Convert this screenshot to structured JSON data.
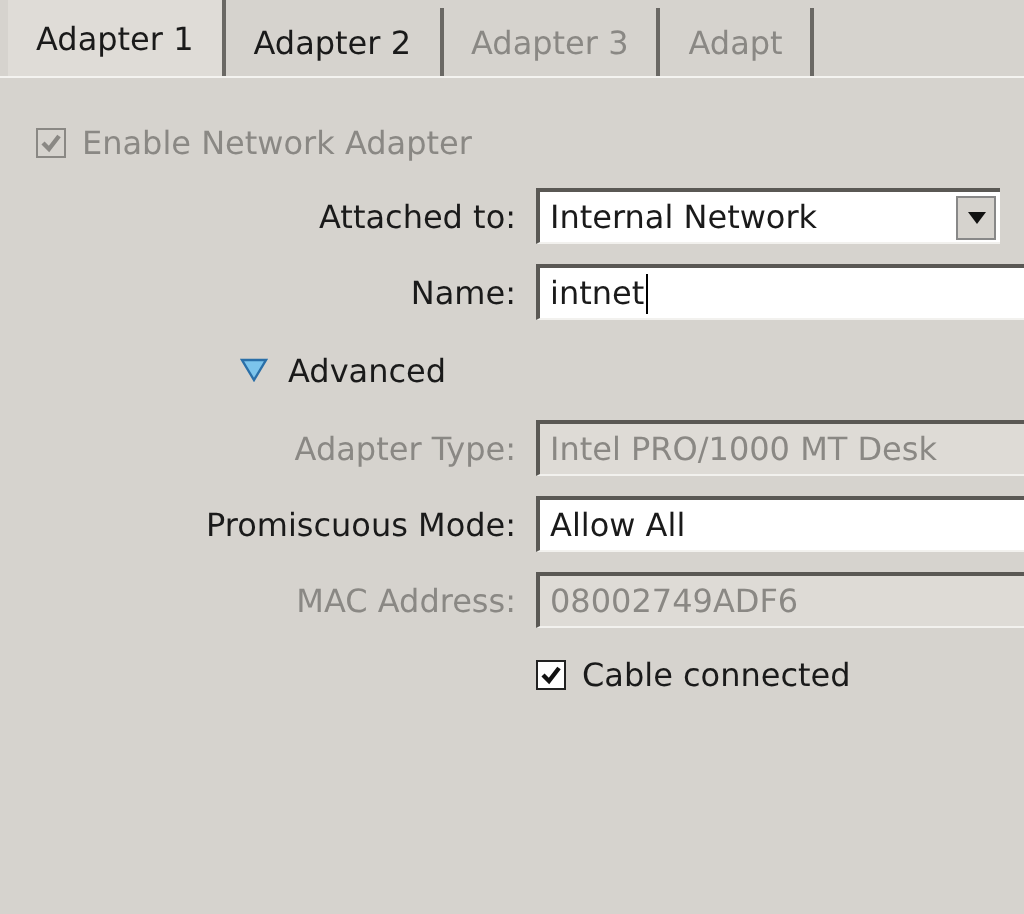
{
  "tabs": [
    {
      "label": "Adapter 1",
      "selected": true,
      "disabled": false
    },
    {
      "label": "Adapter 2",
      "selected": false,
      "disabled": false
    },
    {
      "label": "Adapter 3",
      "selected": false,
      "disabled": true
    },
    {
      "label": "Adapt",
      "selected": false,
      "disabled": true
    }
  ],
  "enable_adapter": {
    "label": "Enable Network Adapter",
    "checked": true,
    "disabled": true
  },
  "fields": [
    {
      "kind": "dropdown",
      "label": "Attached to:",
      "value": "Internal Network",
      "disabled": false
    },
    {
      "kind": "text",
      "label": "Name:",
      "value": "intnet",
      "disabled": false,
      "focused": true
    }
  ],
  "advanced": {
    "label": "Advanced",
    "expanded": true
  },
  "advanced_fields": [
    {
      "kind": "text",
      "label": "Adapter Type:",
      "value": "Intel PRO/1000 MT Desk",
      "disabled": true,
      "focused": false
    },
    {
      "kind": "text",
      "label": "Promiscuous Mode:",
      "value": "Allow All",
      "disabled": false,
      "focused": false
    },
    {
      "kind": "text",
      "label": "MAC Address:",
      "value": "08002749ADF6",
      "disabled": true,
      "focused": false
    }
  ],
  "cable_connected": {
    "label": "Cable connected",
    "checked": true,
    "disabled": false
  }
}
